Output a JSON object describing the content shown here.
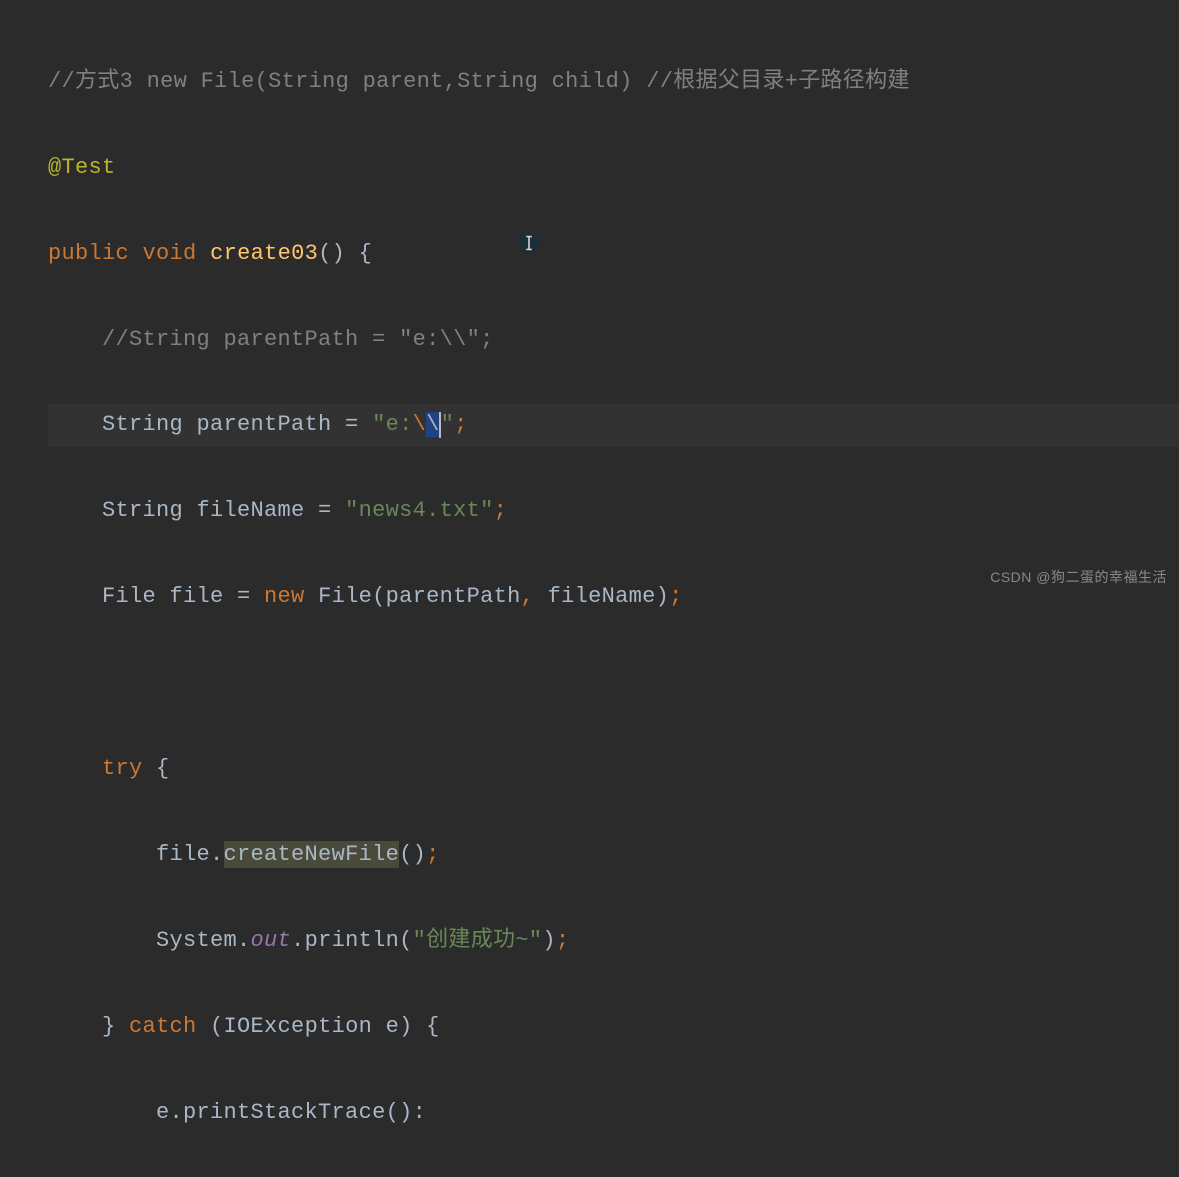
{
  "code": {
    "line1_comment": "//方式3 new File(String parent,String child) //根据父目录+子路径构建",
    "line2_annotation": "@Test",
    "line3_public": "public",
    "line3_void": "void",
    "line3_method": "create03",
    "line3_end": "() {",
    "line4_comment": "//String parentPath = \"e:\\\\\";",
    "line5_type": "String parentPath = ",
    "line5_str_open": "\"e:",
    "line5_esc1": "\\",
    "line5_sel": "\\",
    "line5_str_close": "\"",
    "line5_semi": ";",
    "line6_type": "String fileName = ",
    "line6_str": "\"news4.txt\"",
    "line6_semi": ";",
    "line7_a": "File file = ",
    "line7_new": "new",
    "line7_b": " File(parentPath",
    "line7_comma": ",",
    "line7_c": " fileName)",
    "line7_semi": ";",
    "line9_try": "try",
    "line9_brace": " {",
    "line10_a": "file.",
    "line10_method": "createNewFile",
    "line10_b": "()",
    "line10_semi": ";",
    "line11_a": "System.",
    "line11_out": "out",
    "line11_b": ".println(",
    "line11_str": "\"创建成功~\"",
    "line11_c": ")",
    "line11_semi": ";",
    "line12_close": "} ",
    "line12_catch": "catch",
    "line12_b": " (IOException e) {",
    "line13_a": "e.printStackTrace():"
  },
  "watermark": "CSDN @狗二蛋的幸福生活"
}
